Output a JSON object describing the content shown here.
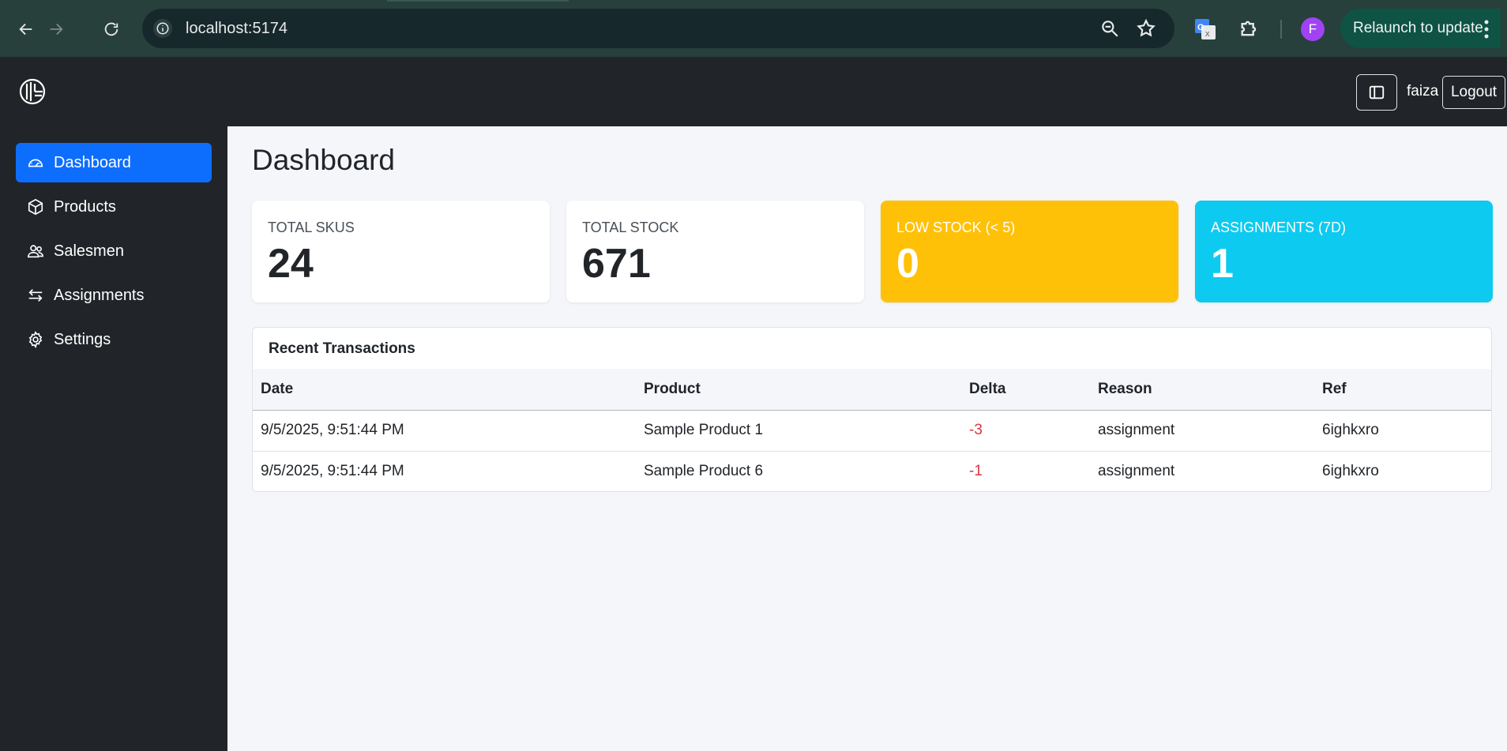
{
  "browser": {
    "url": "localhost:5174",
    "profile_initial": "F",
    "relaunch_label": "Relaunch to update"
  },
  "topbar": {
    "username": "faiza",
    "logout_label": "Logout"
  },
  "sidebar": {
    "items": [
      {
        "label": "Dashboard",
        "icon": "speedometer-icon",
        "active": true
      },
      {
        "label": "Products",
        "icon": "box-icon",
        "active": false
      },
      {
        "label": "Salesmen",
        "icon": "people-icon",
        "active": false
      },
      {
        "label": "Assignments",
        "icon": "arrows-swap-icon",
        "active": false
      },
      {
        "label": "Settings",
        "icon": "gear-icon",
        "active": false
      }
    ]
  },
  "main": {
    "title": "Dashboard",
    "stats": [
      {
        "label": "Total SKUs",
        "value": "24"
      },
      {
        "label": "Total Stock",
        "value": "671"
      },
      {
        "label": "Low Stock (< 5)",
        "value": "0"
      },
      {
        "label": "Assignments (7d)",
        "value": "1"
      }
    ],
    "transactions": {
      "title": "Recent Transactions",
      "columns": [
        "Date",
        "Product",
        "Delta",
        "Reason",
        "Ref"
      ],
      "rows": [
        {
          "date": "9/5/2025, 9:51:44 PM",
          "product": "Sample Product 1",
          "delta": "-3",
          "reason": "assignment",
          "ref": "6ighkxro"
        },
        {
          "date": "9/5/2025, 9:51:44 PM",
          "product": "Sample Product 6",
          "delta": "-1",
          "reason": "assignment",
          "ref": "6ighkxro"
        }
      ]
    }
  },
  "colors": {
    "primary": "#0d6efd",
    "warning": "#ffc107",
    "info": "#0dcaf0",
    "danger": "#dc3545",
    "dark": "#212529"
  }
}
